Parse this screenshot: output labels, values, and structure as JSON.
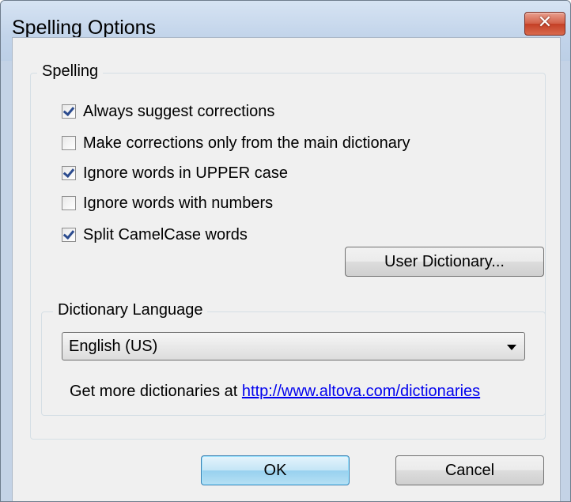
{
  "window": {
    "title": "Spelling Options",
    "close_label": "✕"
  },
  "spelling_group": {
    "legend": "Spelling",
    "options": [
      {
        "label": "Always suggest corrections",
        "checked": true
      },
      {
        "label": "Make corrections only from the main dictionary",
        "checked": false
      },
      {
        "label": "Ignore words in UPPER case",
        "checked": true
      },
      {
        "label": "Ignore words with numbers",
        "checked": false
      },
      {
        "label": "Split CamelCase words",
        "checked": true
      }
    ],
    "user_dictionary_button": "User Dictionary..."
  },
  "language_group": {
    "legend": "Dictionary Language",
    "selected": "English (US)",
    "more_text": "Get more dictionaries at",
    "more_link": "http://www.altova.com/dictionaries"
  },
  "buttons": {
    "ok": "OK",
    "cancel": "Cancel"
  },
  "colors": {
    "link": "#0000ee",
    "check": "#2b4b8e",
    "close": "#c43f26"
  }
}
